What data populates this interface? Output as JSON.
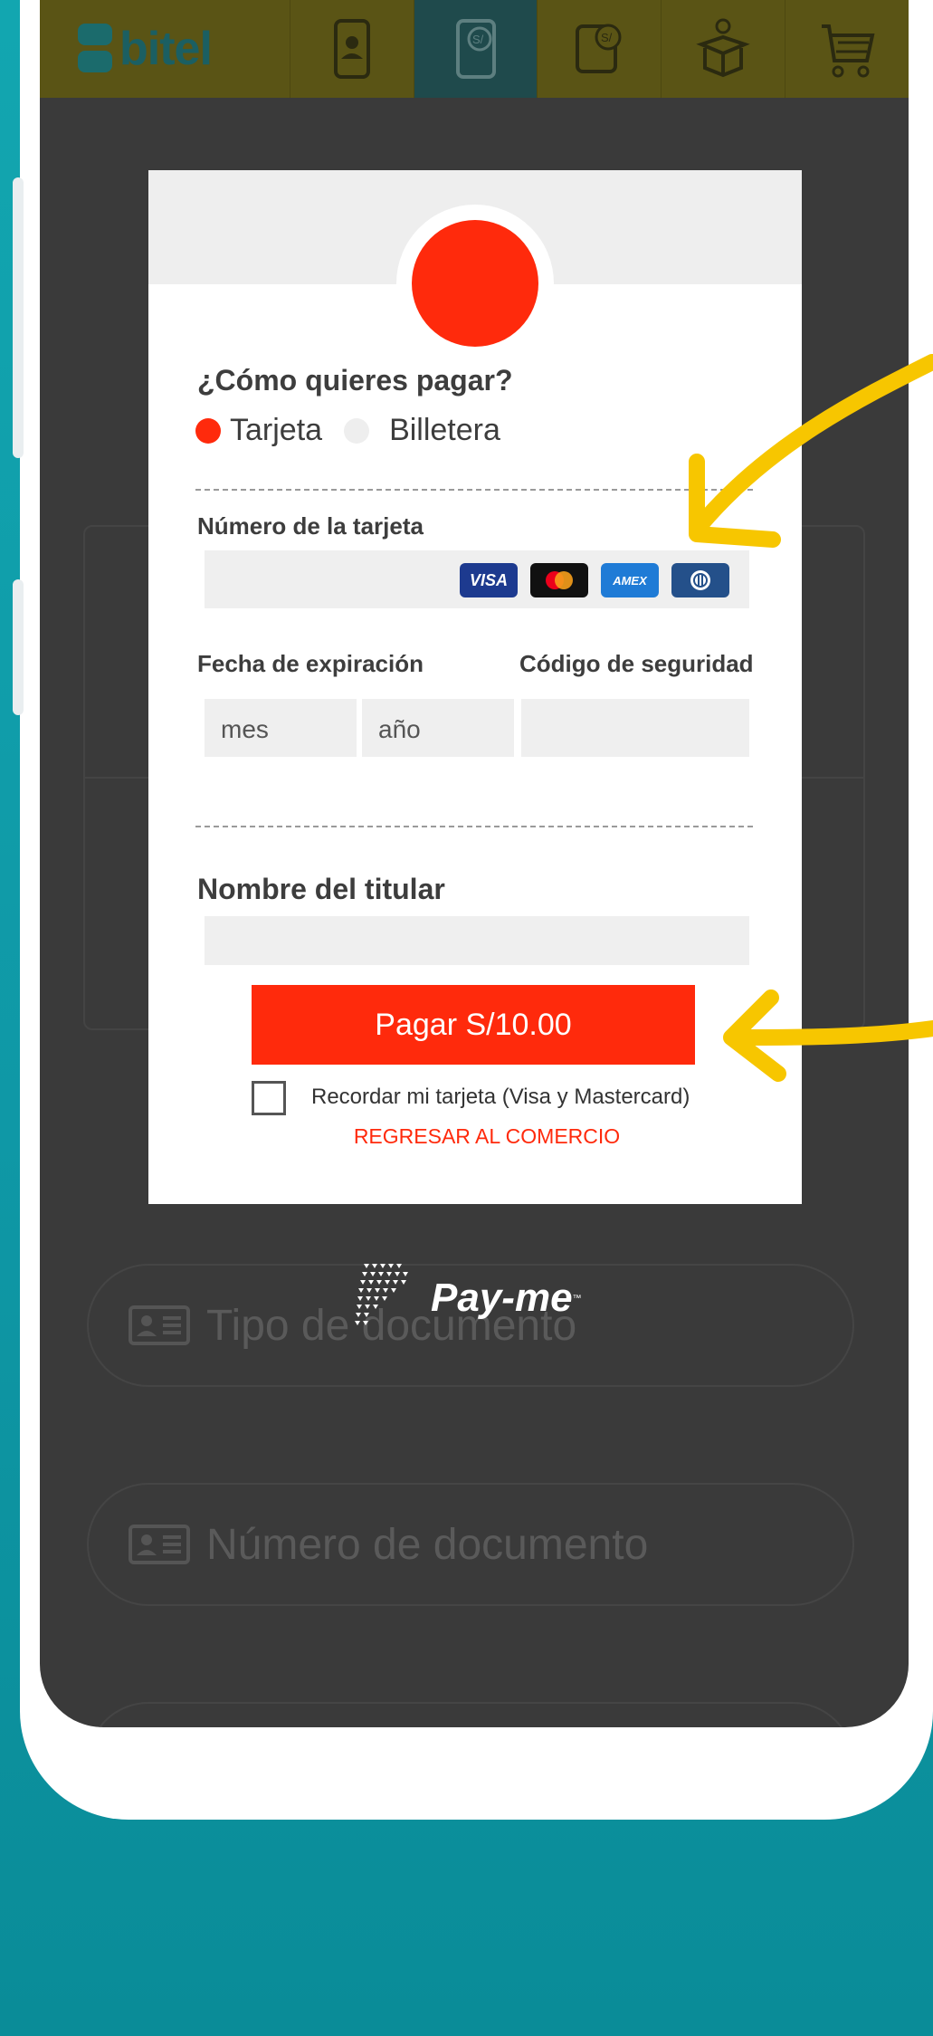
{
  "app": {
    "brand": "bitel",
    "nav_tabs": [
      {
        "icon": "phone-user-icon",
        "active": false
      },
      {
        "icon": "phone-soles-icon",
        "active": true
      },
      {
        "icon": "tablet-soles-icon",
        "active": false
      },
      {
        "icon": "gift-box-icon",
        "active": false
      },
      {
        "icon": "shopping-cart-icon",
        "active": false
      }
    ]
  },
  "background_form": {
    "document_type_placeholder": "Tipo de documento",
    "document_number_placeholder": "Número de documento"
  },
  "payment_modal": {
    "question": "¿Cómo quieres pagar?",
    "methods": [
      {
        "label": "Tarjeta",
        "selected": true
      },
      {
        "label": "Billetera",
        "selected": false
      }
    ],
    "card_number_label": "Número de la tarjeta",
    "card_brands": [
      "VISA",
      "mastercard",
      "AMEX",
      "diners"
    ],
    "expiry_label": "Fecha de expiración",
    "month_placeholder": "mes",
    "year_placeholder": "año",
    "security_code_label": "Código de seguridad",
    "holder_name_label": "Nombre del titular",
    "pay_button": "Pagar S/10.00",
    "remember_card": "Recordar mi tarjeta (Visa y Mastercard)",
    "back_link": "REGRESAR AL COMERCIO"
  },
  "provider": {
    "name": "Pay-me",
    "trademark": "™"
  },
  "colors": {
    "accent_red": "#ff2a0c",
    "topbar_olive": "#5a5415",
    "background_teal": "#12a6b0",
    "arrow_yellow": "#f7c600"
  }
}
